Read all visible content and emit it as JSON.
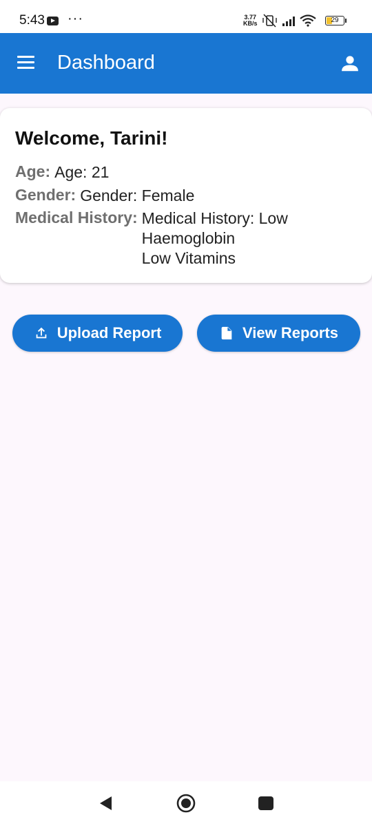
{
  "status_bar": {
    "time": "5:43",
    "dots": "···",
    "network_speed_value": "3.77",
    "network_speed_unit": "KB/s",
    "battery_level": "29"
  },
  "app_bar": {
    "title": "Dashboard",
    "menu_icon": "hamburger-menu-icon",
    "profile_icon": "person-icon",
    "color": "#1976d2"
  },
  "welcome_card": {
    "title": "Welcome, Tarini!",
    "age_label": "Age:",
    "age_value": "Age: 21",
    "gender_label": "Gender:",
    "gender_value": "Gender: Female",
    "history_label": "Medical History:",
    "history_lines": [
      "Medical History: Low",
      "Haemoglobin",
      "Low Vitamins"
    ]
  },
  "actions": {
    "upload_label": "Upload Report",
    "upload_icon": "upload-icon",
    "view_label": "View Reports",
    "view_icon": "document-icon"
  },
  "nav_bar": {
    "back_icon": "back-triangle-icon",
    "home_icon": "home-circle-icon",
    "recents_icon": "recents-square-icon"
  }
}
